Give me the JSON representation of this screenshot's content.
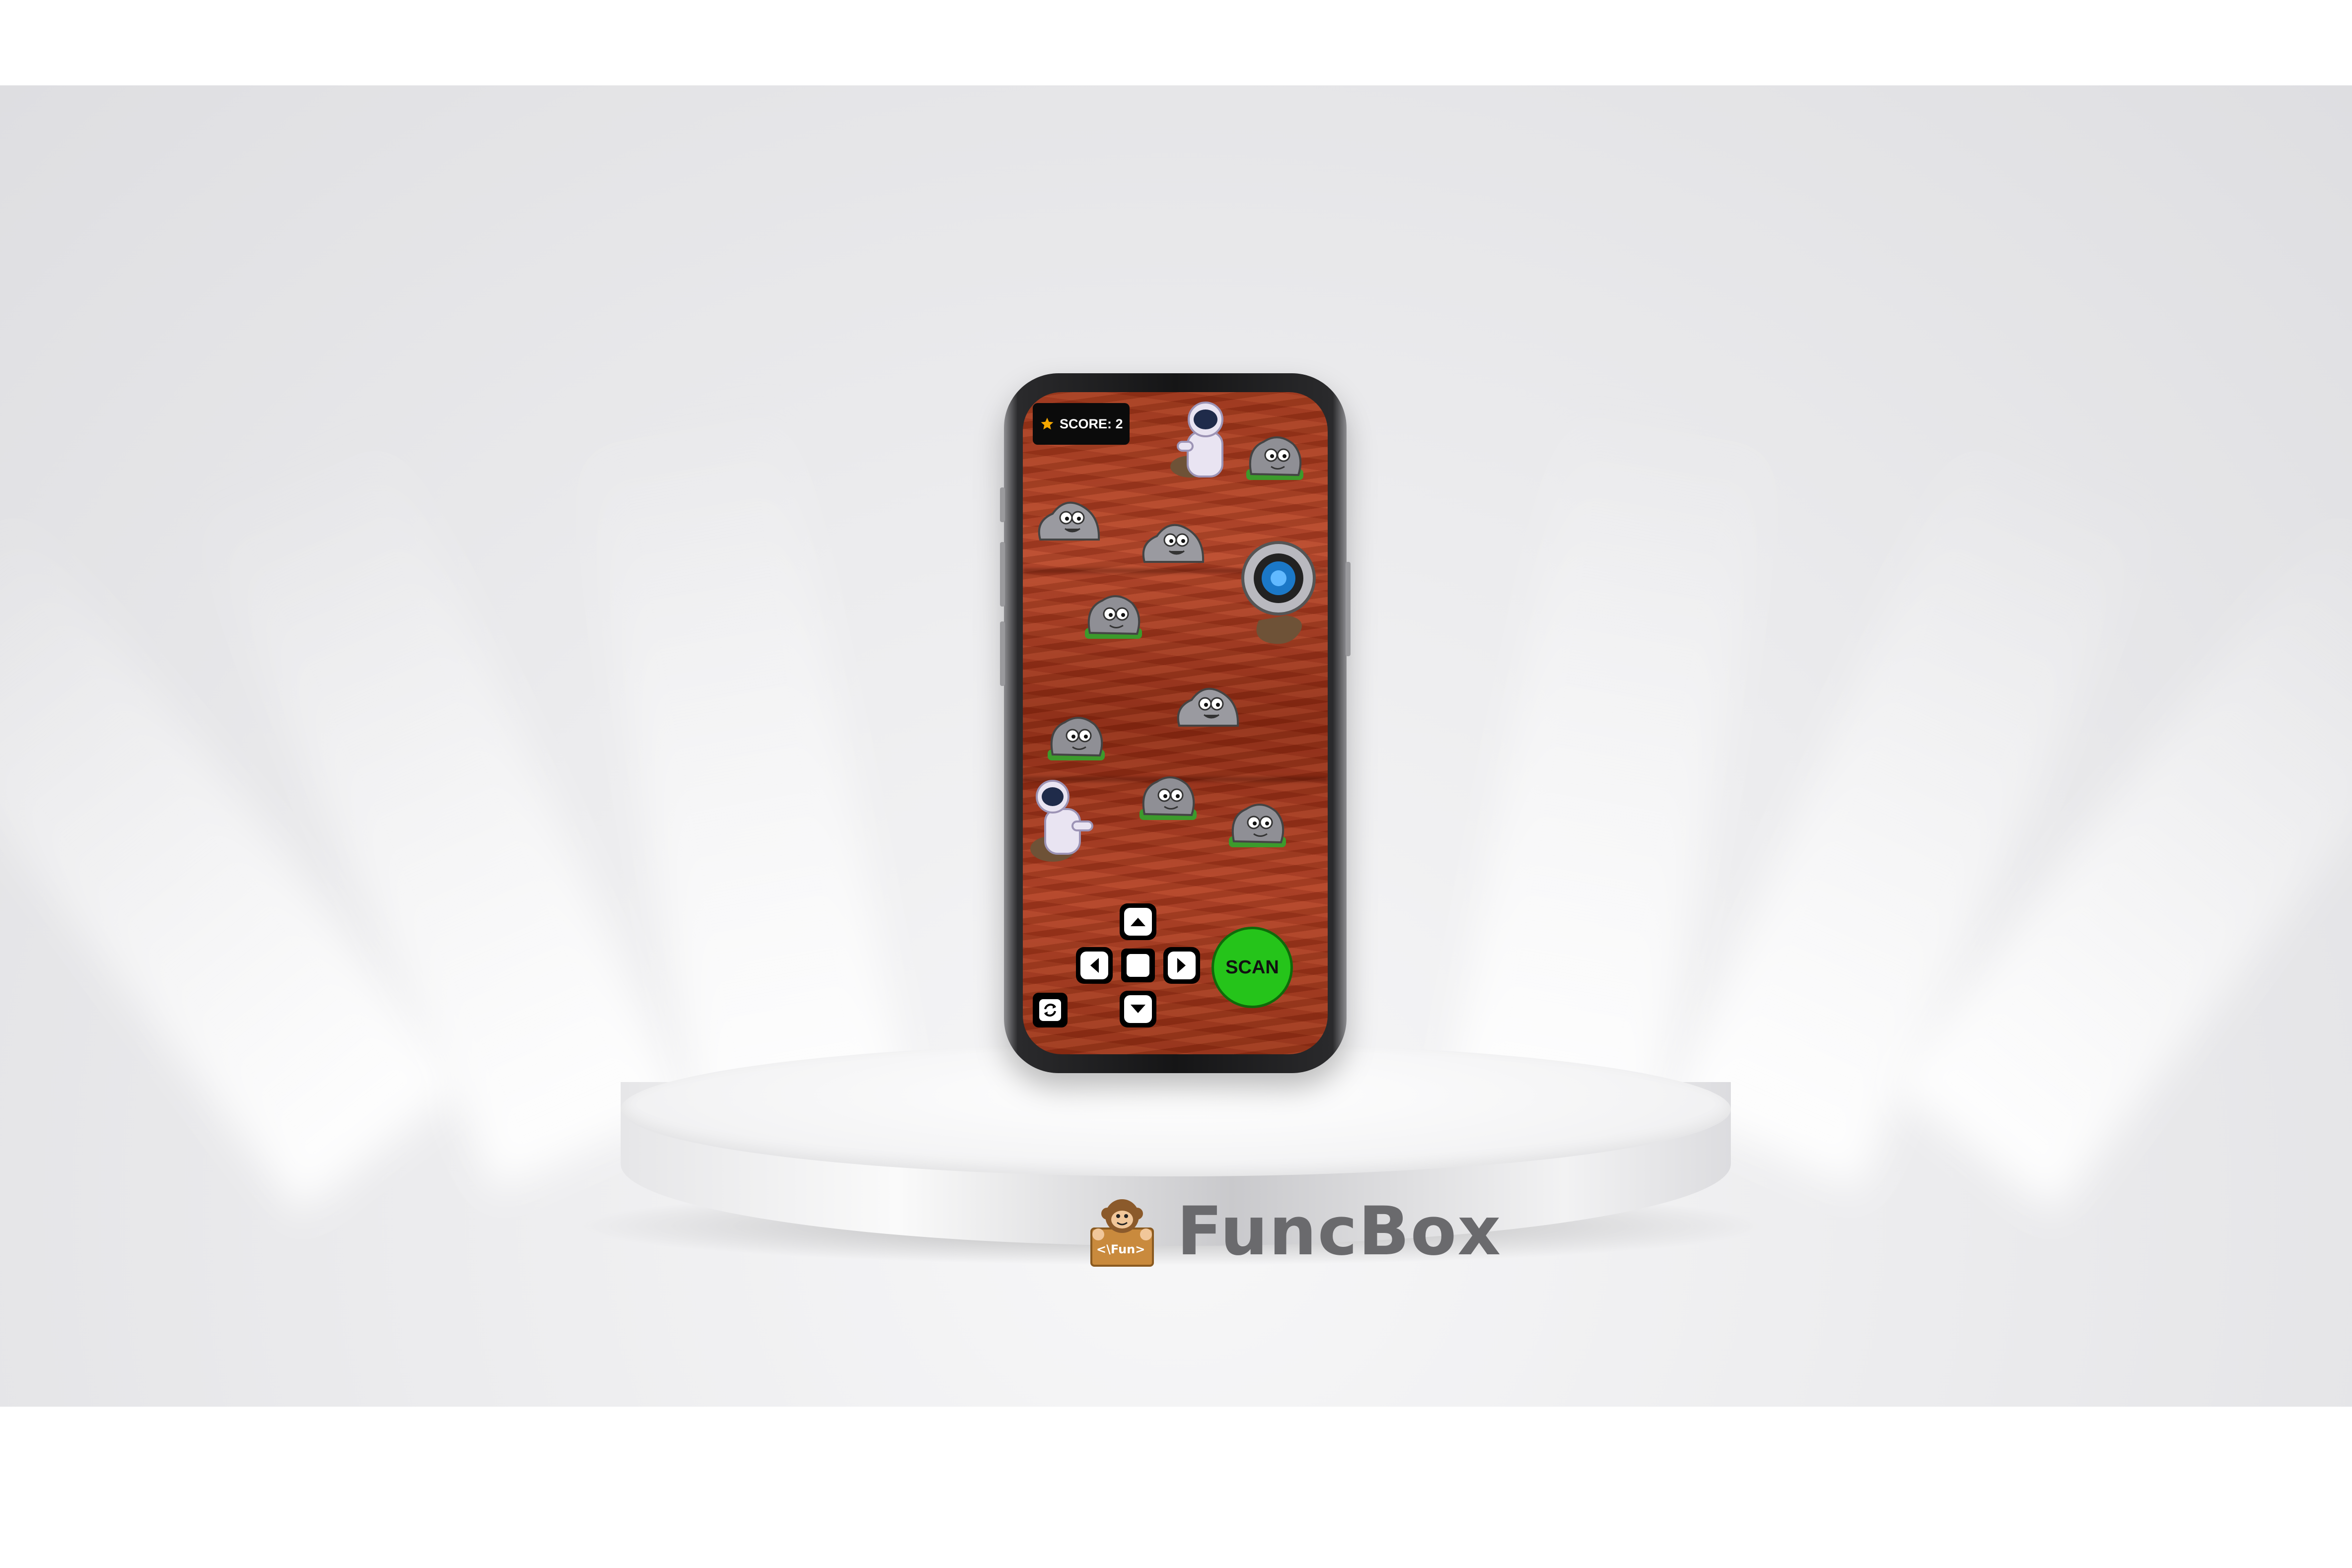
{
  "game": {
    "score_label": "SCORE: 2",
    "scan_label": "SCAN"
  },
  "brand": {
    "name": "FuncBox",
    "logo_text": "<\\Fun>"
  },
  "colors": {
    "mars_surface": "#a3391c",
    "scan_button": "#25c41a",
    "score_star": "#f5a800"
  }
}
